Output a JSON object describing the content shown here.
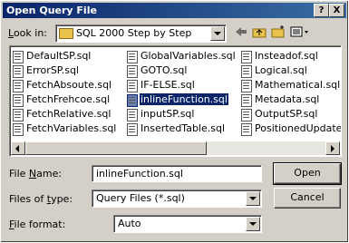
{
  "window": {
    "title": "Open Query File",
    "help_label": "?",
    "close_label": "X"
  },
  "look_in": {
    "label_u": "L",
    "label_rest": "ook in:",
    "value": "SQL 2000 Step by Step"
  },
  "files": [
    [
      "DefaultSP.sql",
      "ErrorSP.sql",
      "FetchAbsoute.sql",
      "FetchFrehcoe.sql",
      "FetchRelative.sql",
      "FetchVariables.sql"
    ],
    [
      "GlobalVariables.sql",
      "GOTO.sql",
      "IF-ELSE.sql",
      "inlineFunction.sql",
      "inputSP.sql",
      "InsertedTable.sql"
    ],
    [
      "Insteadof.sql",
      "Logical.sql",
      "Mathematical.sql",
      "Metadata.sql",
      "OutputSP.sql",
      "PositionedUpdate.sql"
    ]
  ],
  "selected_file": "inlineFunction.sql",
  "file_name": {
    "label_u": "N",
    "label_pre": "File ",
    "label_post": "ame:",
    "value": "inlineFunction.sql"
  },
  "file_type": {
    "label_pre": "Files of ",
    "label_u": "t",
    "label_post": "ype:",
    "value": "Query Files (*.sql)"
  },
  "file_format": {
    "label_u": "F",
    "label_rest": "ile format:",
    "value": "Auto"
  },
  "buttons": {
    "open": "Open",
    "cancel": "Cancel"
  },
  "colors": {
    "title_bar": "#0a246a",
    "face": "#d4d0c8",
    "selection": "#0a246a"
  }
}
